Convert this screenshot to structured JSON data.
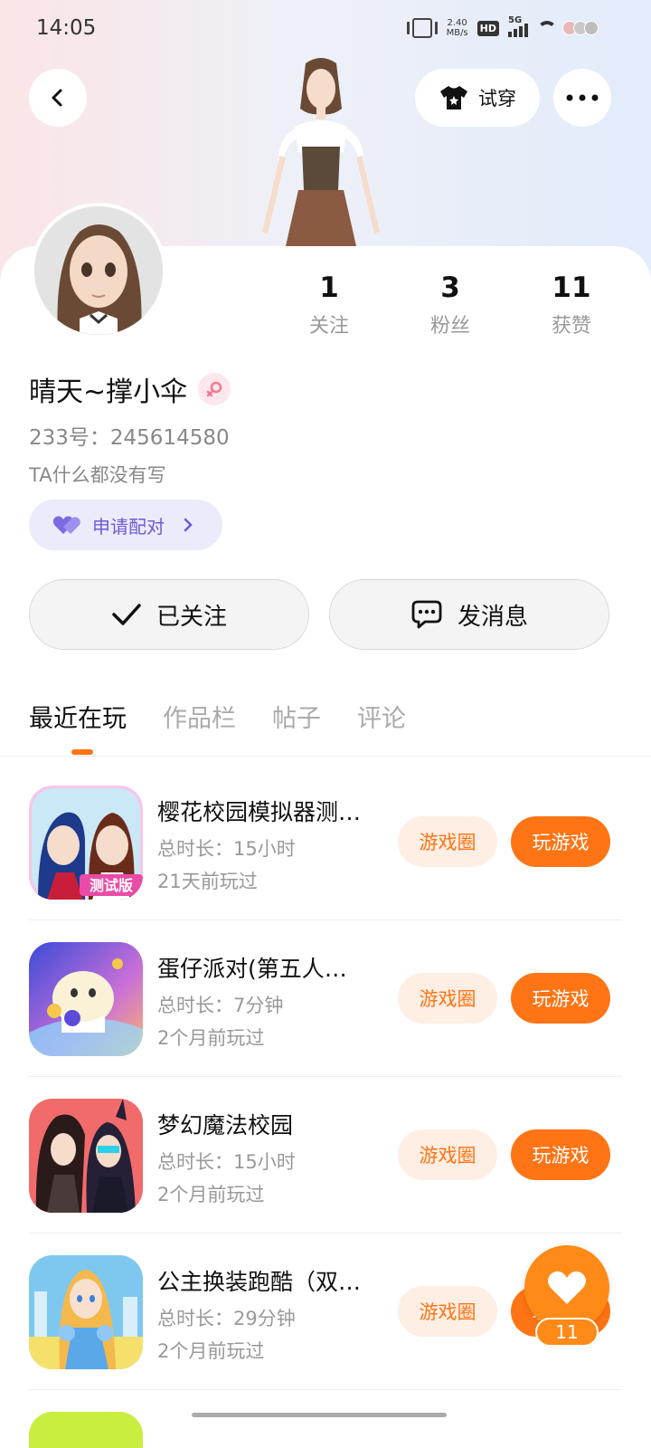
{
  "status_bar": {
    "time": "14:05",
    "net_speed_value": "2.40",
    "net_speed_unit": "MB/s",
    "hd_label": "HD",
    "network_label": "5G"
  },
  "header": {
    "try_on_label": "试穿"
  },
  "profile": {
    "stats": [
      {
        "value": "1",
        "label": "关注"
      },
      {
        "value": "3",
        "label": "粉丝"
      },
      {
        "value": "11",
        "label": "获赞"
      }
    ],
    "username": "晴天~撑小伞",
    "user_id": "233号：245614580",
    "bio": "TA什么都没有写",
    "pair_label": "申请配对"
  },
  "actions": {
    "followed_label": "已关注",
    "message_label": "发消息"
  },
  "tabs": [
    "最近在玩",
    "作品栏",
    "帖子",
    "评论"
  ],
  "games": [
    {
      "name": "樱花校园模拟器测…",
      "duration": "总时长：15小时",
      "last_played": "21天前玩过",
      "circle_label": "游戏圈",
      "play_label": "玩游戏"
    },
    {
      "name": "蛋仔派对(第五人…",
      "duration": "总时长：7分钟",
      "last_played": "2个月前玩过",
      "circle_label": "游戏圈",
      "play_label": "玩游戏"
    },
    {
      "name": "梦幻魔法校园",
      "duration": "总时长：15小时",
      "last_played": "2个月前玩过",
      "circle_label": "游戏圈",
      "play_label": "玩游戏"
    },
    {
      "name": "公主换装跑酷（双…",
      "duration": "总时长：29分钟",
      "last_played": "2个月前玩过",
      "circle_label": "游戏圈",
      "play_label": "玩游戏"
    }
  ],
  "like_fab": {
    "count": "11"
  },
  "colors": {
    "accent": "#ff7414",
    "accent_light": "#ffeee3",
    "pair_bg": "#ecebfb",
    "pair_text": "#6b5bd9"
  }
}
